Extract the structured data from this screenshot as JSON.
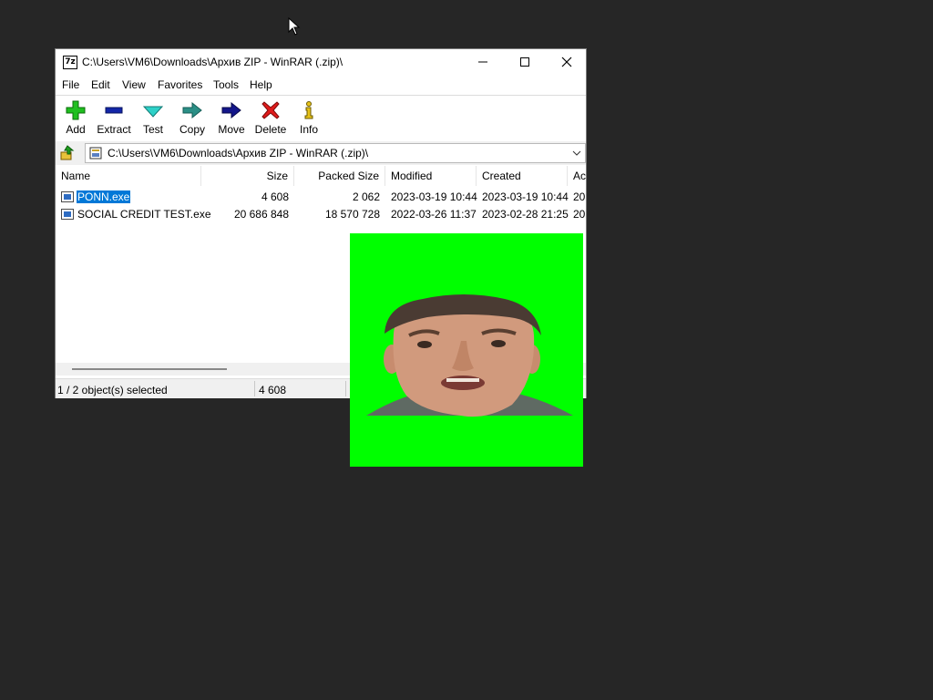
{
  "window": {
    "title": "C:\\Users\\VM6\\Downloads\\Архив ZIP - WinRAR (.zip)\\",
    "app_icon_text": "7z"
  },
  "menu": [
    "File",
    "Edit",
    "View",
    "Favorites",
    "Tools",
    "Help"
  ],
  "toolbar": {
    "add": "Add",
    "extract": "Extract",
    "test": "Test",
    "copy": "Copy",
    "move": "Move",
    "delete": "Delete",
    "info": "Info"
  },
  "address": {
    "path": "C:\\Users\\VM6\\Downloads\\Архив ZIP - WinRAR (.zip)\\"
  },
  "columns": [
    "Name",
    "Size",
    "Packed Size",
    "Modified",
    "Created",
    "Ac"
  ],
  "files": [
    {
      "name": "PONN.exe",
      "size": "4 608",
      "packed": "2 062",
      "modified": "2023-03-19 10:44",
      "created": "2023-03-19 10:44",
      "accessed": "202",
      "selected": true
    },
    {
      "name": "SOCIAL CREDIT TEST.exe",
      "size": "20 686 848",
      "packed": "18 570 728",
      "modified": "2022-03-26 11:37",
      "created": "2023-02-28 21:25",
      "accessed": "202",
      "selected": false
    }
  ],
  "status": {
    "selection": "1 / 2 object(s) selected",
    "size": "4 608"
  },
  "colors": {
    "desktop": "#262626",
    "selection": "#0078d7",
    "overlay_green": "#00ff00"
  }
}
